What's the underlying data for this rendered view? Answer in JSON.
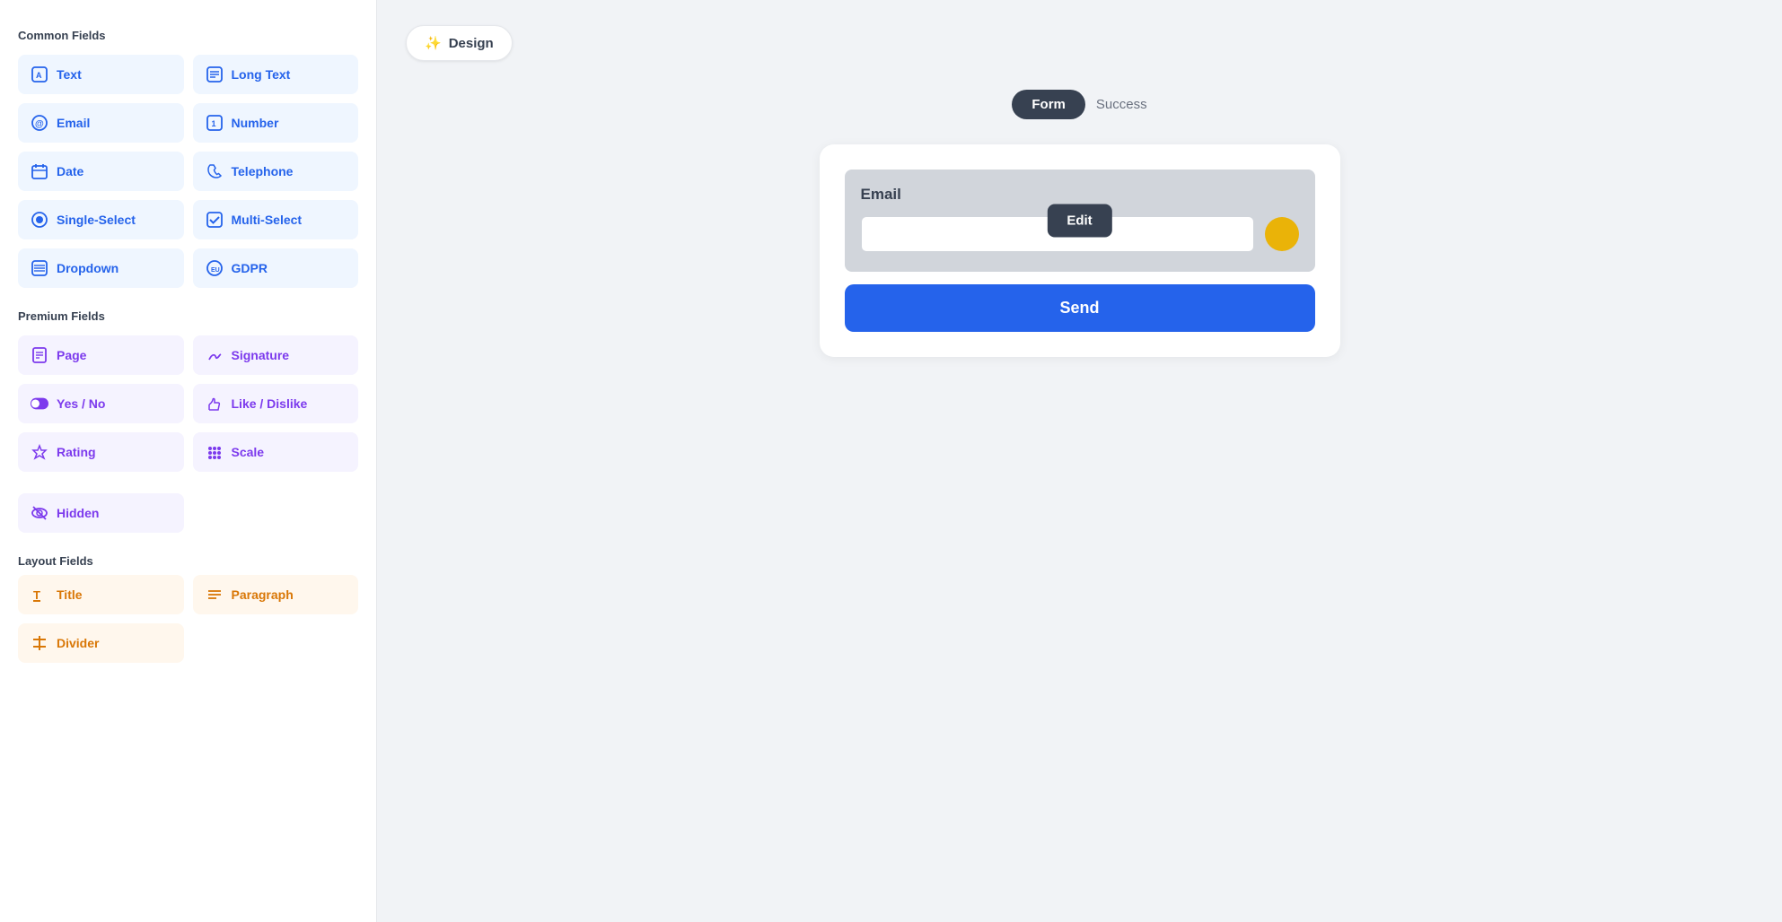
{
  "sidebar": {
    "common_title": "Common Fields",
    "premium_title": "Premium Fields",
    "layout_title": "Layout Fields",
    "common_fields": [
      {
        "id": "text",
        "label": "Text",
        "icon": "🅰"
      },
      {
        "id": "long-text",
        "label": "Long Text",
        "icon": "✏"
      },
      {
        "id": "email",
        "label": "Email",
        "icon": "＠"
      },
      {
        "id": "number",
        "label": "Number",
        "icon": "①"
      },
      {
        "id": "date",
        "label": "Date",
        "icon": "📅"
      },
      {
        "id": "telephone",
        "label": "Telephone",
        "icon": "📞"
      },
      {
        "id": "single-select",
        "label": "Single-Select",
        "icon": "🎯"
      },
      {
        "id": "multi-select",
        "label": "Multi-Select",
        "icon": "☑"
      },
      {
        "id": "dropdown",
        "label": "Dropdown",
        "icon": "☰"
      },
      {
        "id": "gdpr",
        "label": "GDPR",
        "icon": "🇪🇺"
      }
    ],
    "premium_fields": [
      {
        "id": "page",
        "label": "Page",
        "icon": "📄"
      },
      {
        "id": "signature",
        "label": "Signature",
        "icon": "✍"
      },
      {
        "id": "yes-no",
        "label": "Yes / No",
        "icon": "⏺"
      },
      {
        "id": "like-dislike",
        "label": "Like / Dislike",
        "icon": "👍"
      },
      {
        "id": "rating",
        "label": "Rating",
        "icon": "⭐"
      },
      {
        "id": "scale",
        "label": "Scale",
        "icon": "⠿"
      },
      {
        "id": "hidden",
        "label": "Hidden",
        "icon": "👁"
      }
    ],
    "layout_fields": [
      {
        "id": "title",
        "label": "Title",
        "icon": "T"
      },
      {
        "id": "paragraph",
        "label": "Paragraph",
        "icon": "≡"
      },
      {
        "id": "divider",
        "label": "Divider",
        "icon": "÷"
      }
    ]
  },
  "main": {
    "design_btn_label": "Design",
    "design_icon": "✨",
    "tab_form": "Form",
    "tab_success": "Success",
    "email_label": "Email",
    "edit_btn_label": "Edit",
    "send_btn_label": "Send"
  }
}
